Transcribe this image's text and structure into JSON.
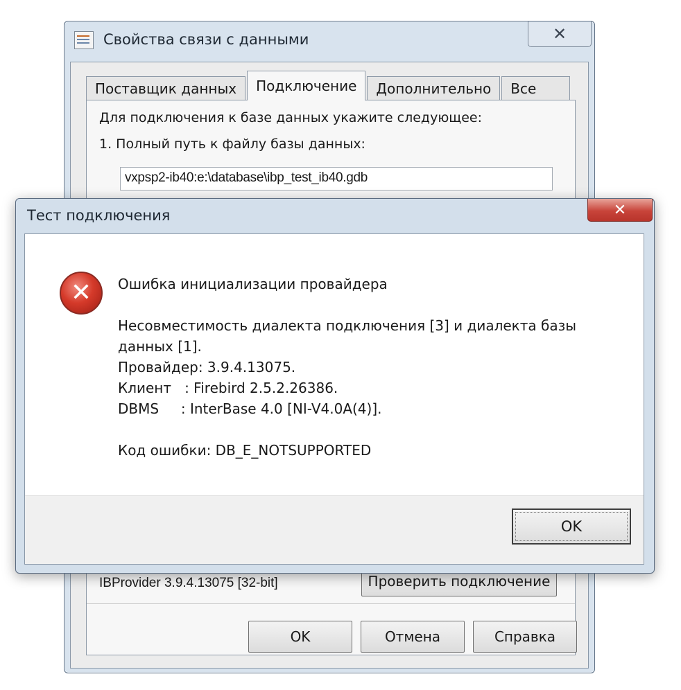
{
  "back_dialog": {
    "title": "Свойства связи с данными",
    "close_glyph": "✕",
    "tabs": [
      "Поставщик данных",
      "Подключение",
      "Дополнительно",
      "Все"
    ],
    "active_tab": "Подключение",
    "instruction": "Для подключения к базе данных укажите следующее:",
    "step1_label": "1. Полный путь к файлу базы данных:",
    "path_value": "vxpsp2-ib40:e:\\database\\ibp_test_ib40.gdb",
    "provider_version": "IBProvider 3.9.4.13075 [32-bit]",
    "test_button": "Проверить подключение",
    "ok_button": "OK",
    "cancel_button": "Отмена",
    "help_button": "Справка"
  },
  "front_dialog": {
    "title": "Тест подключения",
    "close_glyph": "✕",
    "icon": "error-icon",
    "heading": "Ошибка инициализации провайдера",
    "message_lines": [
      "Несовместимость диалекта подключения [3] и диалекта базы",
      "данных [1].",
      "Провайдер: 3.9.4.13075.",
      "Клиент   : Firebird 2.5.2.26386.",
      "DBMS     : InterBase 4.0 [NI-V4.0A(4)]."
    ],
    "error_code": "Код ошибки: DB_E_NOTSUPPORTED",
    "ok_button": "OK"
  },
  "colors": {
    "window_frame": "#d8e3ee",
    "error_red": "#d53a2a",
    "close_red": "#c8443a"
  }
}
